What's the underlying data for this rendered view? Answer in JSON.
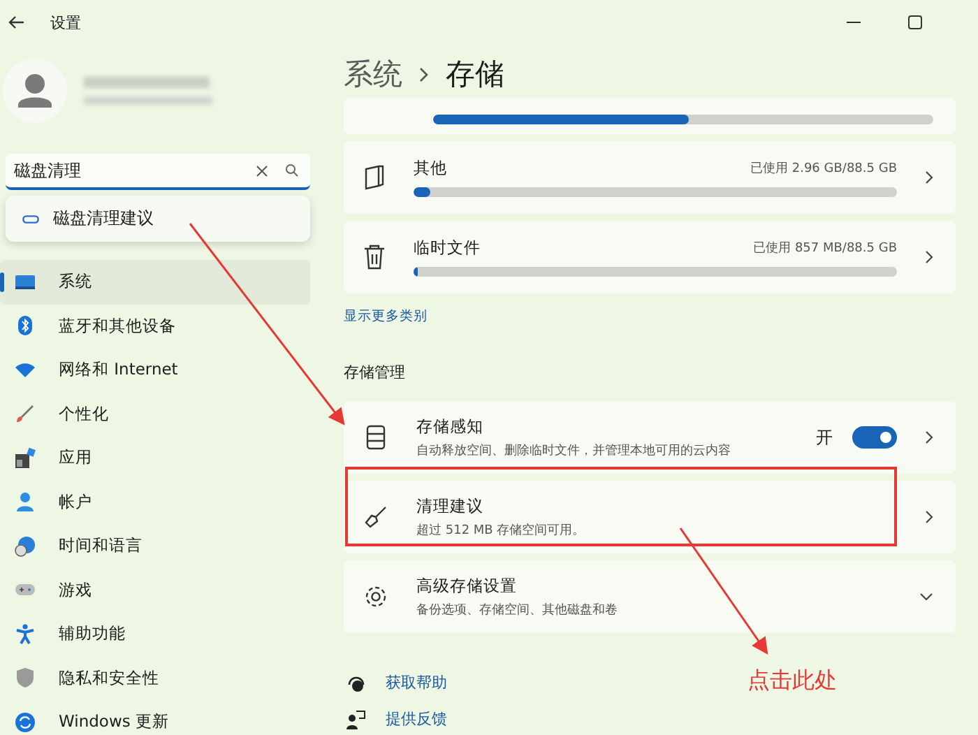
{
  "window": {
    "title": "设置"
  },
  "search": {
    "value": "磁盘清理",
    "suggestions": [
      "磁盘清理建议"
    ]
  },
  "sidebar": {
    "items": [
      {
        "label": "系统",
        "selected": true
      },
      {
        "label": "蓝牙和其他设备",
        "selected": false
      },
      {
        "label": "网络和 Internet",
        "selected": false
      },
      {
        "label": "个性化",
        "selected": false
      },
      {
        "label": "应用",
        "selected": false
      },
      {
        "label": "帐户",
        "selected": false
      },
      {
        "label": "时间和语言",
        "selected": false
      },
      {
        "label": "游戏",
        "selected": false
      },
      {
        "label": "辅助功能",
        "selected": false
      },
      {
        "label": "隐私和安全性",
        "selected": false
      },
      {
        "label": "Windows 更新",
        "selected": false
      }
    ]
  },
  "breadcrumb": [
    "系统",
    "存储"
  ],
  "top_card": {
    "level": 0.51
  },
  "categories": [
    {
      "name": "其他",
      "usage": "已使用 2.96 GB/88.5 GB",
      "level": 0.035
    },
    {
      "name": "临时文件",
      "usage": "已使用 857 MB/88.5 GB",
      "level": 0.008
    }
  ],
  "show_more": "显示更多类别",
  "section_title": "存储管理",
  "management": [
    {
      "kind": "toggle",
      "title": "存储感知",
      "subtitle": "自动释放空间、删除临时文件，并管理本地可用的云内容",
      "state_label": "开",
      "on": true
    },
    {
      "kind": "link",
      "title": "清理建议",
      "subtitle": "超过 512 MB 存储空间可用。"
    },
    {
      "kind": "expander",
      "title": "高级存储设置",
      "subtitle": "备份选项、存储空间、其他磁盘和卷",
      "expanded": false
    }
  ],
  "help_links": [
    "获取帮助",
    "提供反馈"
  ],
  "annotation": {
    "text": "点击此处"
  }
}
